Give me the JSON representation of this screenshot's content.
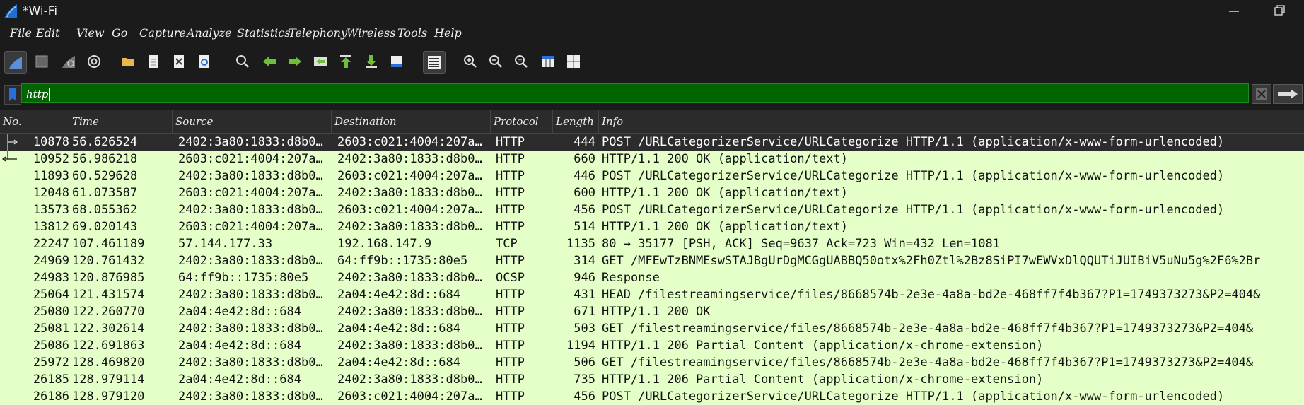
{
  "window": {
    "title": "*Wi-Fi"
  },
  "menu": [
    "File",
    "Edit",
    "View",
    "Go",
    "Capture",
    "Analyze",
    "Statistics",
    "Telephony",
    "Wireless",
    "Tools",
    "Help"
  ],
  "filter": {
    "value": "http"
  },
  "columns": [
    "No.",
    "Time",
    "Source",
    "Destination",
    "Protocol",
    "Length",
    "Info"
  ],
  "packets": [
    {
      "no": "10878",
      "time": "56.626524",
      "src": "2402:3a80:1833:d8b0…",
      "dst": "2603:c021:4004:207a…",
      "proto": "HTTP",
      "len": "444",
      "info": "POST /URLCategorizerService/URLCategorize HTTP/1.1  (application/x-www-form-urlencoded)"
    },
    {
      "no": "10952",
      "time": "56.986218",
      "src": "2603:c021:4004:207a…",
      "dst": "2402:3a80:1833:d8b0…",
      "proto": "HTTP",
      "len": "660",
      "info": "HTTP/1.1 200 OK  (application/text)"
    },
    {
      "no": "11893",
      "time": "60.529628",
      "src": "2402:3a80:1833:d8b0…",
      "dst": "2603:c021:4004:207a…",
      "proto": "HTTP",
      "len": "446",
      "info": "POST /URLCategorizerService/URLCategorize HTTP/1.1  (application/x-www-form-urlencoded)"
    },
    {
      "no": "12048",
      "time": "61.073587",
      "src": "2603:c021:4004:207a…",
      "dst": "2402:3a80:1833:d8b0…",
      "proto": "HTTP",
      "len": "600",
      "info": "HTTP/1.1 200 OK  (application/text)"
    },
    {
      "no": "13573",
      "time": "68.055362",
      "src": "2402:3a80:1833:d8b0…",
      "dst": "2603:c021:4004:207a…",
      "proto": "HTTP",
      "len": "456",
      "info": "POST /URLCategorizerService/URLCategorize HTTP/1.1  (application/x-www-form-urlencoded)"
    },
    {
      "no": "13812",
      "time": "69.020143",
      "src": "2603:c021:4004:207a…",
      "dst": "2402:3a80:1833:d8b0…",
      "proto": "HTTP",
      "len": "514",
      "info": "HTTP/1.1 200 OK  (application/text)"
    },
    {
      "no": "22247",
      "time": "107.461189",
      "src": "57.144.177.33",
      "dst": "192.168.147.9",
      "proto": "TCP",
      "len": "1135",
      "info": "80 → 35177 [PSH, ACK] Seq=9637 Ack=723 Win=432 Len=1081"
    },
    {
      "no": "24969",
      "time": "120.761432",
      "src": "2402:3a80:1833:d8b0…",
      "dst": "64:ff9b::1735:80e5",
      "proto": "HTTP",
      "len": "314",
      "info": "GET /MFEwTzBNMEswSTAJBgUrDgMCGgUABBQ50otx%2Fh0Ztl%2Bz8SiPI7wEWVxDlQQUTiJUIBiV5uNu5g%2F6%2Br"
    },
    {
      "no": "24983",
      "time": "120.876985",
      "src": "64:ff9b::1735:80e5",
      "dst": "2402:3a80:1833:d8b0…",
      "proto": "OCSP",
      "len": "946",
      "info": "Response"
    },
    {
      "no": "25064",
      "time": "121.431574",
      "src": "2402:3a80:1833:d8b0…",
      "dst": "2a04:4e42:8d::684",
      "proto": "HTTP",
      "len": "431",
      "info": "HEAD /filestreamingservice/files/8668574b-2e3e-4a8a-bd2e-468ff7f4b367?P1=1749373273&P2=404&"
    },
    {
      "no": "25080",
      "time": "122.260770",
      "src": "2a04:4e42:8d::684",
      "dst": "2402:3a80:1833:d8b0…",
      "proto": "HTTP",
      "len": "671",
      "info": "HTTP/1.1 200 OK"
    },
    {
      "no": "25081",
      "time": "122.302614",
      "src": "2402:3a80:1833:d8b0…",
      "dst": "2a04:4e42:8d::684",
      "proto": "HTTP",
      "len": "503",
      "info": "GET /filestreamingservice/files/8668574b-2e3e-4a8a-bd2e-468ff7f4b367?P1=1749373273&P2=404&"
    },
    {
      "no": "25086",
      "time": "122.691863",
      "src": "2a04:4e42:8d::684",
      "dst": "2402:3a80:1833:d8b0…",
      "proto": "HTTP",
      "len": "1194",
      "info": "HTTP/1.1 206 Partial Content  (application/x-chrome-extension)"
    },
    {
      "no": "25972",
      "time": "128.469820",
      "src": "2402:3a80:1833:d8b0…",
      "dst": "2a04:4e42:8d::684",
      "proto": "HTTP",
      "len": "506",
      "info": "GET /filestreamingservice/files/8668574b-2e3e-4a8a-bd2e-468ff7f4b367?P1=1749373273&P2=404&"
    },
    {
      "no": "26185",
      "time": "128.979114",
      "src": "2a04:4e42:8d::684",
      "dst": "2402:3a80:1833:d8b0…",
      "proto": "HTTP",
      "len": "735",
      "info": "HTTP/1.1 206 Partial Content  (application/x-chrome-extension)"
    },
    {
      "no": "26186",
      "time": "128.979120",
      "src": "2402:3a80:1833:d8b0…",
      "dst": "2603:c021:4004:207a…",
      "proto": "HTTP",
      "len": "456",
      "info": "POST /URLCategorizerService/URLCategorize HTTP/1.1  (application/x-www-form-urlencoded)"
    }
  ]
}
